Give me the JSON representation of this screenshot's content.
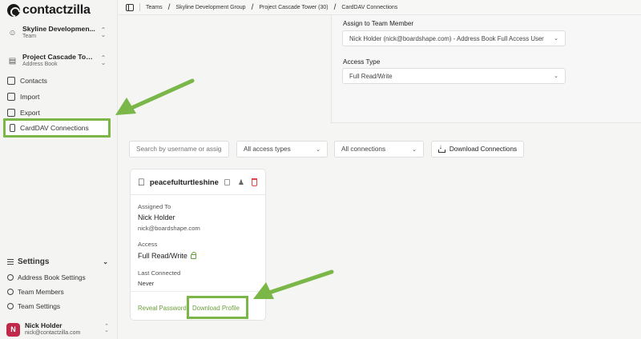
{
  "brand": {
    "name": "contactzilla"
  },
  "team_switcher": {
    "name": "Skyline Developmen...",
    "sub": "Team"
  },
  "book_switcher": {
    "name": "Project Cascade Tow...",
    "sub": "Address Book"
  },
  "nav": {
    "contacts": "Contacts",
    "import": "Import",
    "export": "Export",
    "carddav": "CardDAV Connections"
  },
  "settings": {
    "title": "Settings",
    "items": [
      "Address Book Settings",
      "Team Members",
      "Team Settings"
    ]
  },
  "user": {
    "name": "Nick Holder",
    "email": "nick@contactzilla.com",
    "initial": "N"
  },
  "breadcrumb": [
    "Teams",
    "Skyline Development Group",
    "Project Cascade Tower (30)",
    "CardDAV Connections"
  ],
  "form": {
    "assign_label": "Assign to Team Member",
    "assign_value": "Nick Holder (nick@boardshape.com) - Address Book Full Access User",
    "access_label": "Access Type",
    "access_value": "Full Read/Write"
  },
  "toolbar": {
    "search_placeholder": "Search by username or assignee",
    "access_filter": "All access types",
    "conn_filter": "All connections",
    "download_label": "Download Connections"
  },
  "connection": {
    "username": "peacefulturtleshine",
    "assigned_label": "Assigned To",
    "assigned_name": "Nick Holder",
    "assigned_email": "nick@boardshape.com",
    "access_label": "Access",
    "access_value": "Full Read/Write",
    "last_label": "Last Connected",
    "last_value": "Never",
    "reveal_label": "Reveal Password",
    "download_label": "Download Profile"
  },
  "colors": {
    "accent": "#7ab648",
    "link": "#6a9e3a",
    "danger": "#e04444",
    "avatar": "#c0294a"
  }
}
